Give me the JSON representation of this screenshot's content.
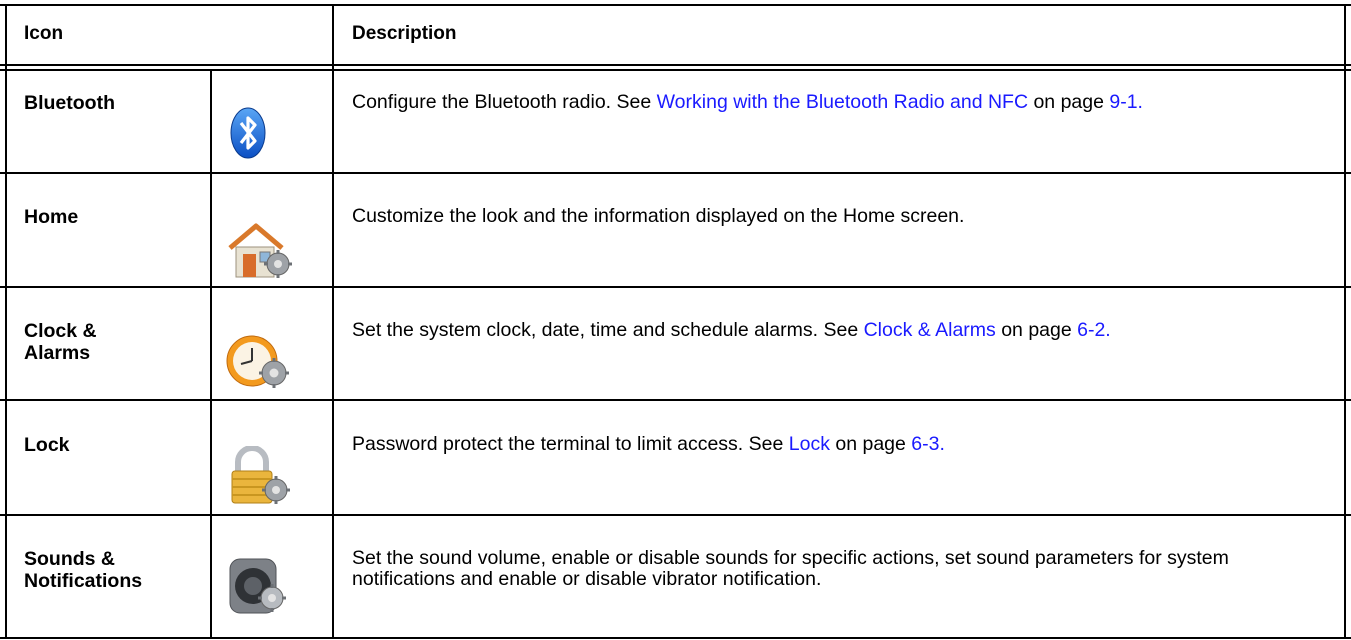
{
  "header": {
    "col_icon": "Icon",
    "col_description": "Description"
  },
  "rows": [
    {
      "name": "Bluetooth",
      "icon": "bluetooth-icon",
      "desc_pre": "Configure the Bluetooth radio. See ",
      "link1": "Working with the Bluetooth Radio and NFC",
      "desc_mid": " on page ",
      "link2": "9-1.",
      "desc_post": ""
    },
    {
      "name": "Home",
      "icon": "home-settings-icon",
      "desc": "Customize the look and the information displayed on the Home screen."
    },
    {
      "name_line1": "Clock &",
      "name_line2": "Alarms",
      "icon": "clock-settings-icon",
      "desc_pre": "Set the system clock, date, time and schedule alarms. See ",
      "link1": "Clock & Alarms",
      "desc_mid": " on page ",
      "link2": "6-2."
    },
    {
      "name": "Lock",
      "icon": "padlock-settings-icon",
      "desc_pre": "Password protect the terminal to limit access. See ",
      "link1": "Lock",
      "desc_mid": " on page ",
      "link2": "6-3."
    },
    {
      "name_line1": "Sounds &",
      "name_line2": "Notifications",
      "icon": "speaker-settings-icon",
      "desc": "Set the sound volume, enable or disable sounds for specific actions, set sound parameters for system notifications and enable or disable vibrator notification."
    }
  ]
}
